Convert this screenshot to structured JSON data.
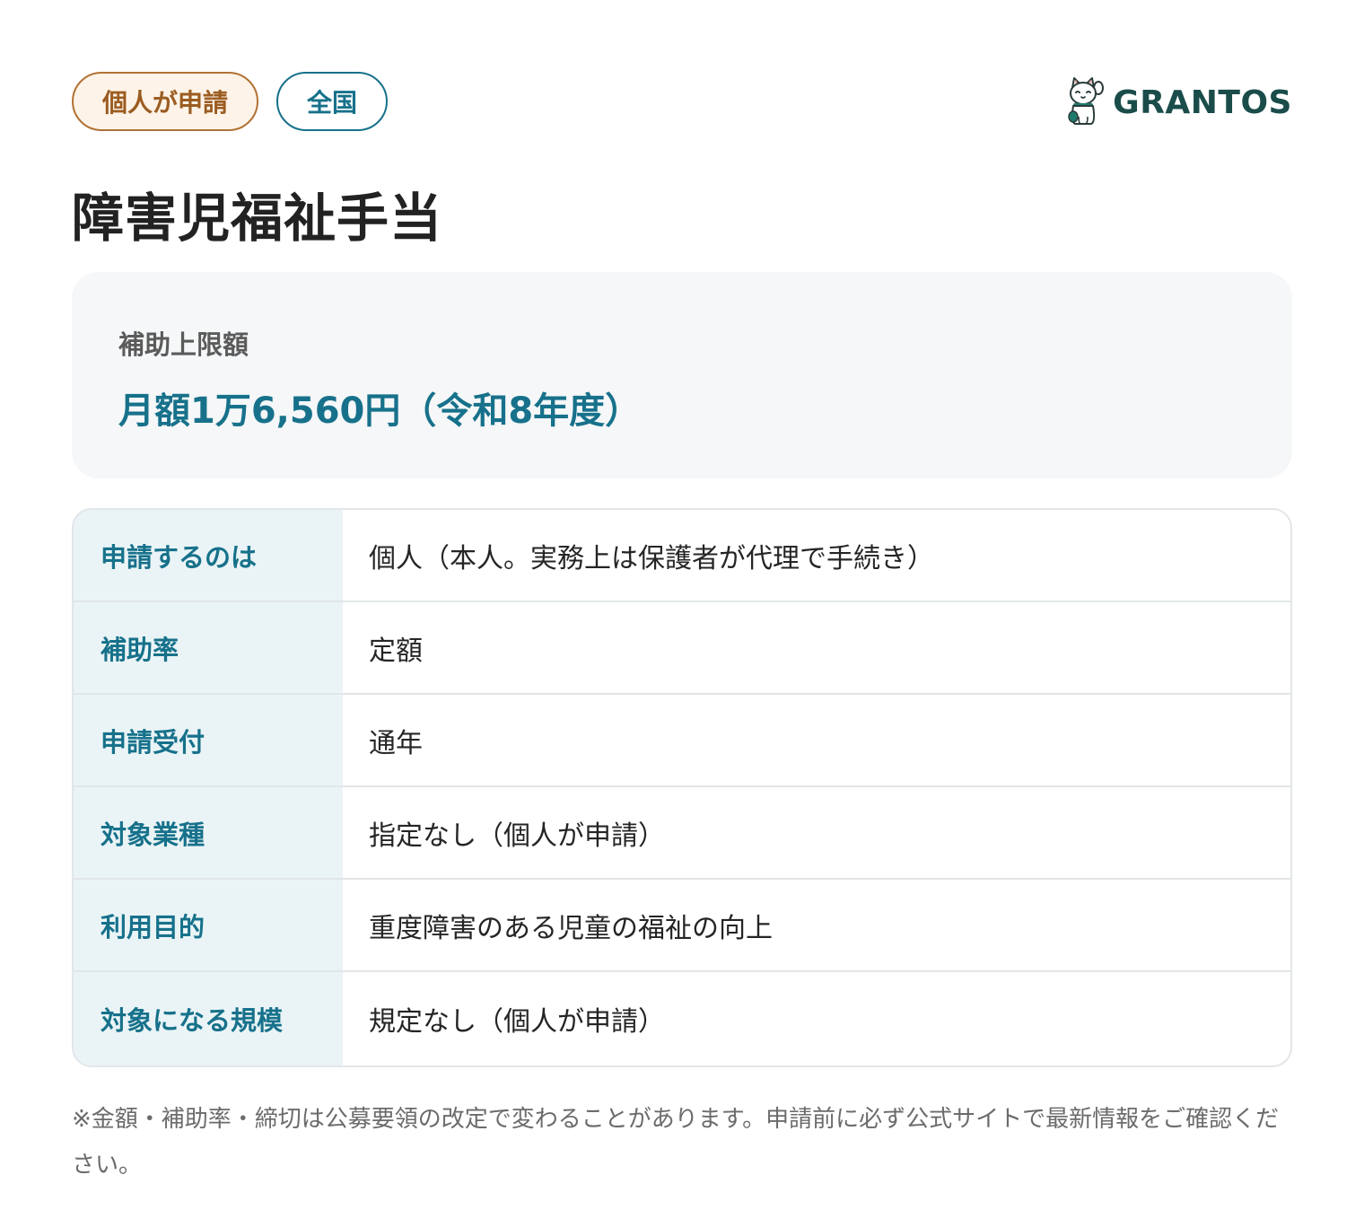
{
  "tags": {
    "applicant": "個人が申請",
    "region": "全国"
  },
  "logo": {
    "text": "GRANTOS",
    "icon": "lucky-cat-icon",
    "color": "#1a4c4a"
  },
  "title": "障害児福祉手当",
  "summary": {
    "label": "補助上限額",
    "value": "月額1万6,560円（令和8年度）"
  },
  "table": {
    "rows": [
      {
        "key": "申請するのは",
        "value": "個人（本人。実務上は保護者が代理で手続き）"
      },
      {
        "key": "補助率",
        "value": "定額"
      },
      {
        "key": "申請受付",
        "value": "通年"
      },
      {
        "key": "対象業種",
        "value": "指定なし（個人が申請）"
      },
      {
        "key": "利用目的",
        "value": "重度障害のある児童の福祉の向上"
      },
      {
        "key": "対象になる規模",
        "value": "規定なし（個人が申請）"
      }
    ]
  },
  "note": "※金額・補助率・締切は公募要領の改定で変わることがあります。申請前に必ず公式サイトで最新情報をご確認ください。",
  "colors": {
    "accent": "#17718b",
    "tag_personal": "#9b5c21",
    "key_background": "#eaf4f6",
    "summary_background": "#f5f7f8"
  }
}
